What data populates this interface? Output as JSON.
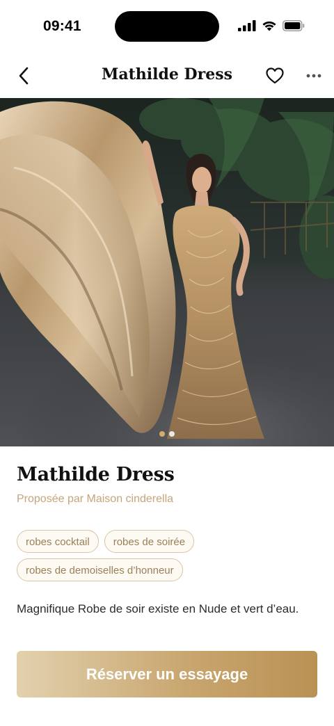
{
  "status_bar": {
    "time": "09:41"
  },
  "nav": {
    "title": "Mathilde Dress",
    "back_icon": "chevron-left-icon",
    "favorite_icon": "heart-icon",
    "more_icon": "more-horizontal-icon"
  },
  "gallery": {
    "image_count": 2,
    "active_index": 0
  },
  "product": {
    "title": "Mathilde Dress",
    "vendor": "Proposée par Maison cinderella",
    "tags": [
      "robes cocktail",
      "robes de soirée",
      "robes de demoiselles d’honneur"
    ],
    "description": "Magnifique Robe de soir existe en Nude et vert d’eau."
  },
  "cta": {
    "label": "Réserver un essayage"
  },
  "colors": {
    "accent": "#c5a579",
    "tag_border": "#d9c4a3",
    "cta_start": "#e2d1ae",
    "cta_end": "#b99154"
  }
}
